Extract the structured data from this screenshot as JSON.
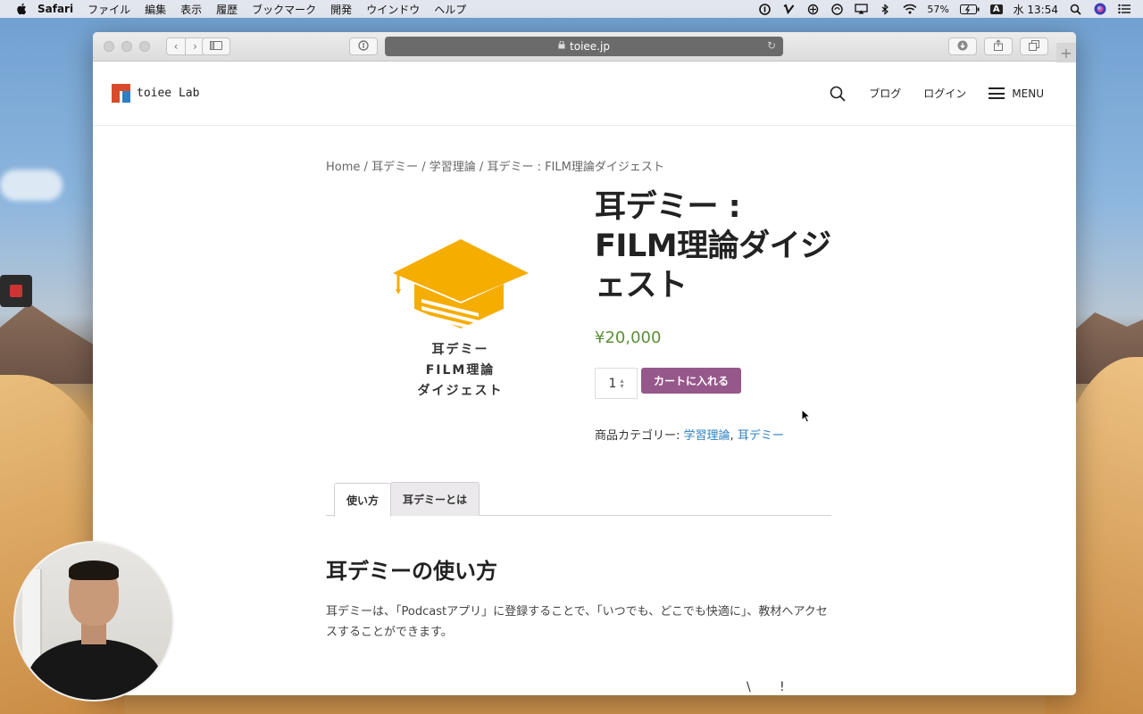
{
  "menubar": {
    "app_name": "Safari",
    "items": [
      "ファイル",
      "編集",
      "表示",
      "履歴",
      "ブックマーク",
      "開発",
      "ウインドウ",
      "ヘルプ"
    ],
    "battery": "57%",
    "input_method": "A",
    "clock": "水 13:54"
  },
  "browser": {
    "url": "toiee.jp"
  },
  "site": {
    "logo_text": "toiee Lab",
    "nav_blog": "ブログ",
    "nav_login": "ログイン",
    "menu_label": "MENU"
  },
  "breadcrumb": {
    "items": [
      "Home",
      "耳デミー",
      "学習理論",
      "耳デミー : FILM理論ダイジェスト"
    ],
    "separator": "/"
  },
  "product": {
    "image_label_lines": [
      "耳デミー",
      "FILM理論",
      "ダイジェスト"
    ],
    "title": "耳デミー : FILM理論ダイジェスト",
    "price": "¥20,000",
    "quantity": "1",
    "add_to_cart": "カートに入れる",
    "category_label": "商品カテゴリー:",
    "categories": [
      "学習理論",
      "耳デミー"
    ],
    "category_separator": ","
  },
  "tabs": [
    "使い方",
    "耳デミーとは"
  ],
  "section": {
    "title": "耳デミーの使い方",
    "body": "耳デミーは、「Podcastアプリ」に登録することで、「いつでも、どこでも快適に」、教材へアクセスすることができます。"
  },
  "stray_glyphs": [
    "\\",
    "!"
  ],
  "colors": {
    "price_green": "#5c8f37",
    "cart_button": "#96588a",
    "link_blue": "#2c7fc0",
    "cap_yellow": "#f5ad00"
  }
}
